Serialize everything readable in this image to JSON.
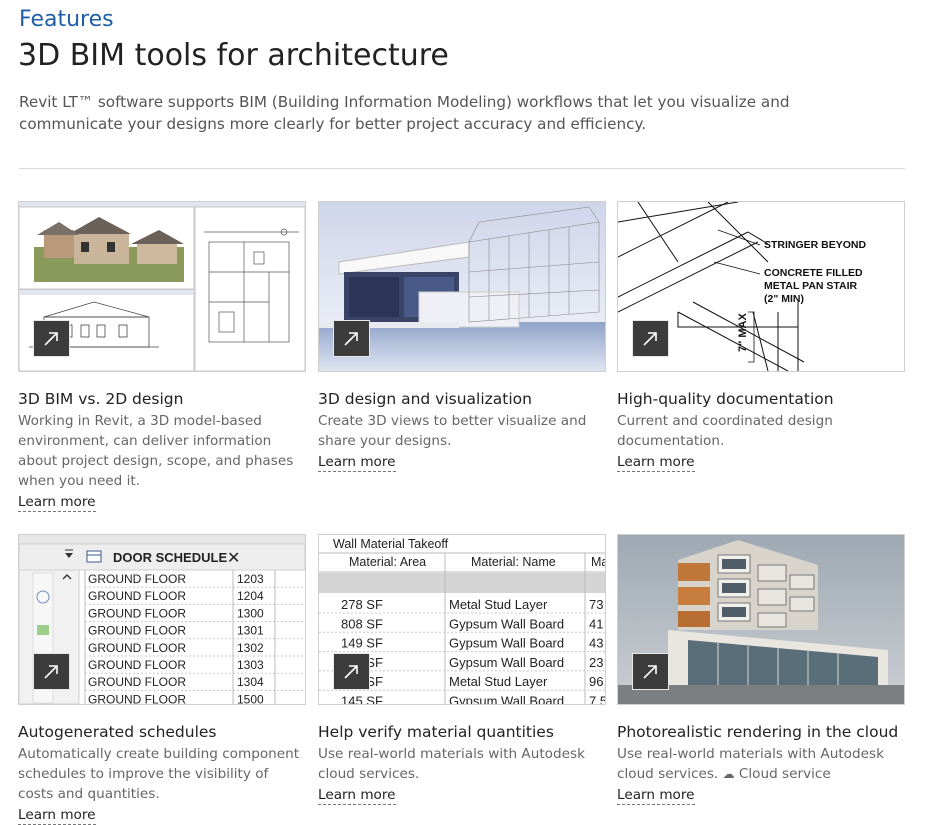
{
  "header": {
    "eyebrow": "Features",
    "title": "3D BIM tools for architecture",
    "intro": "Revit LT™ software supports BIM (Building Information Modeling) workflows that let you visualize and communicate your designs more clearly for better project accuracy and efficiency."
  },
  "cards": [
    {
      "title": "3D BIM vs. 2D design",
      "description": "Working in Revit, a 3D model-based environment, can deliver information about project design, scope, and phases when you need it.",
      "link": "Learn more",
      "image": "revit-interface-screenshot"
    },
    {
      "title": "3D design and visualization",
      "description": "Create 3D views to better visualize and share your designs.",
      "link": "Learn more",
      "image": "modern-house-render-with-wireframe"
    },
    {
      "title": "High-quality documentation",
      "description": "Current and coordinated design documentation.",
      "link": "Learn more",
      "image": "stair-detail-drawing",
      "image_labels": [
        "STRINGER BEYOND",
        "CONCRETE FILLED",
        "METAL PAN STAIR",
        "(2\" MIN)",
        "7\" MAX"
      ]
    },
    {
      "title": "Autogenerated schedules",
      "description": "Automatically create building component schedules to improve the visibility of costs and quantities.",
      "link": "Learn more",
      "image": "door-schedule-screenshot",
      "schedule": {
        "title": "DOOR SCHEDULE",
        "rows": [
          [
            "GROUND FLOOR",
            "1203"
          ],
          [
            "GROUND FLOOR",
            "1204"
          ],
          [
            "GROUND FLOOR",
            "1300"
          ],
          [
            "GROUND FLOOR",
            "1301"
          ],
          [
            "GROUND FLOOR",
            "1302"
          ],
          [
            "GROUND FLOOR",
            "1303"
          ],
          [
            "GROUND FLOOR",
            "1304"
          ],
          [
            "GROUND FLOOR",
            "1500"
          ]
        ]
      }
    },
    {
      "title": "Help verify material quantities",
      "description": "Use real-world materials with Autodesk cloud services.",
      "link": "Learn more",
      "image": "material-takeoff-screenshot",
      "takeoff": {
        "title": "Wall Material Takeoff",
        "headers": [
          "Material: Area",
          "Material: Name",
          "Ma"
        ],
        "rows": [
          [
            "278 SF",
            "Metal Stud Layer",
            "73"
          ],
          [
            "808 SF",
            "Gypsum Wall Board",
            "41"
          ],
          [
            "149 SF",
            "Gypsum Wall Board",
            "43"
          ],
          [
            "447 SF",
            "Gypsum Wall Board",
            "23"
          ],
          [
            "447 SF",
            "Metal Stud Layer",
            "96"
          ],
          [
            "145 SF",
            "Gypsum Wall Board",
            "7.5"
          ]
        ]
      }
    },
    {
      "title": "Photorealistic rendering in the cloud",
      "description": "Use real-world materials with Autodesk cloud services.",
      "cloud_tag": "Cloud service",
      "link": "Learn more",
      "image": "apartment-building-render"
    }
  ],
  "icons": {
    "expand": "expand-arrow-icon",
    "cloud": "cloud-icon"
  },
  "colors": {
    "eyebrow": "#1f5fa8",
    "expand_button": "#3c3c3c"
  }
}
